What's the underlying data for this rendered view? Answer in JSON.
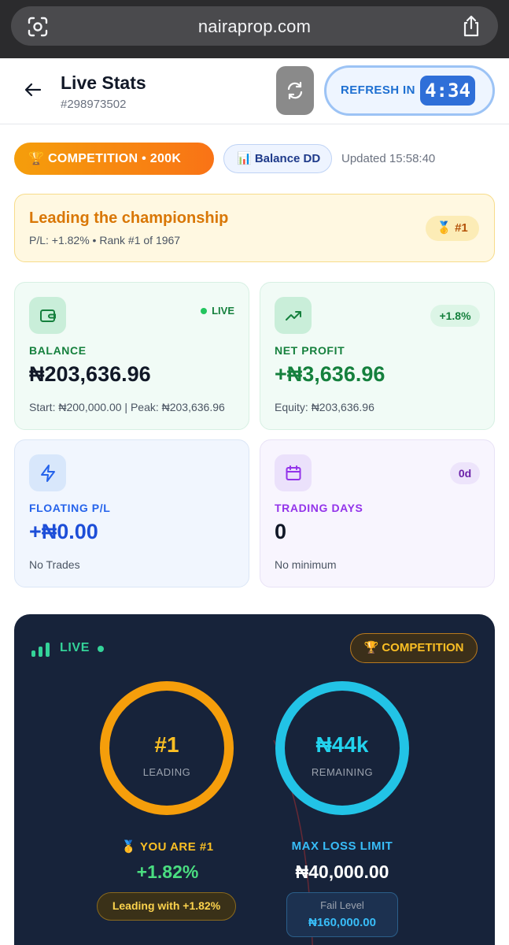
{
  "browser": {
    "url": "nairaprop.com"
  },
  "header": {
    "title": "Live Stats",
    "account_id": "#298973502",
    "refresh_label": "REFRESH IN",
    "refresh_timer": "4:34"
  },
  "badges": {
    "competition": "🏆 COMPETITION • 200K",
    "balance_dd": "📊 Balance DD",
    "updated": "Updated 15:58:40"
  },
  "leading": {
    "heading": "Leading the championship",
    "detail": "P/L: +1.82% • Rank #1 of 1967",
    "rank_badge": "🥇 #1"
  },
  "stats": {
    "balance": {
      "label": "BALANCE",
      "value": "₦203,636.96",
      "sub": "Start: ₦200,000.00 | Peak: ₦203,636.96",
      "tag": "LIVE"
    },
    "net_profit": {
      "label": "NET PROFIT",
      "value": "+₦3,636.96",
      "sub": "Equity: ₦203,636.96",
      "tag": "+1.8%"
    },
    "floating": {
      "label": "FLOATING P/L",
      "value": "+₦0.00",
      "sub": "No Trades"
    },
    "trading_days": {
      "label": "TRADING DAYS",
      "value": "0",
      "sub": "No minimum",
      "tag": "0d"
    }
  },
  "live_panel": {
    "live_label": "LIVE",
    "competition_tag": "🏆 COMPETITION",
    "rank_ring": {
      "main": "#1",
      "sub": "LEADING",
      "progress": 1.0
    },
    "loss_ring": {
      "main": "₦44k",
      "sub": "REMAINING",
      "progress": 1.0
    },
    "you_are": "🥇 YOU ARE #1",
    "pnl_pct": "+1.82%",
    "leading_with": "Leading with +1.82%",
    "max_loss_label": "MAX LOSS LIMIT",
    "max_loss_value": "₦40,000.00",
    "fail_level_label": "Fail Level",
    "fail_level_value": "₦160,000.00"
  },
  "colors": {
    "accent_blue": "#2f6fd8",
    "orange": "#f59e0b",
    "green": "#15803d",
    "cyan": "#22c3e6",
    "dark_panel": "#17233a"
  }
}
